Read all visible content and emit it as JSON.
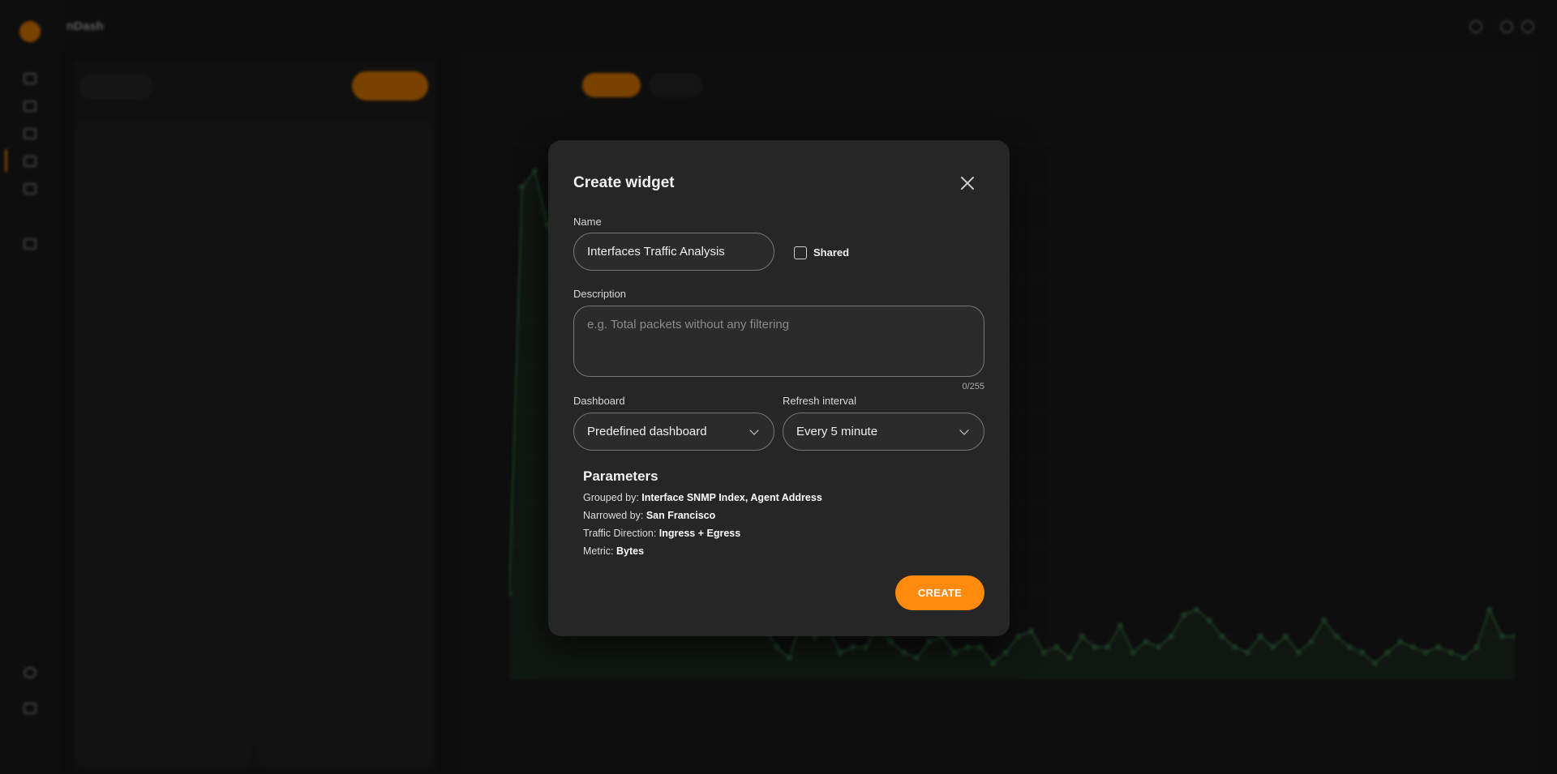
{
  "background": {
    "app_title": "nDash"
  },
  "modal": {
    "title": "Create widget",
    "name_label": "Name",
    "name_value": "Interfaces Traffic Analysis",
    "shared_label": "Shared",
    "shared_checked": false,
    "description_label": "Description",
    "description_placeholder": "e.g. Total packets without any filtering",
    "description_value": "",
    "char_counter": "0/255",
    "dashboard_label": "Dashboard",
    "dashboard_value": "Predefined dashboard",
    "refresh_label": "Refresh interval",
    "refresh_value": "Every 5 minute",
    "params_title": "Parameters",
    "params": [
      {
        "label": "Grouped by: ",
        "value": "Interface SNMP Index, Agent Address"
      },
      {
        "label": "Narrowed by: ",
        "value": "San Francisco"
      },
      {
        "label": "Traffic Direction: ",
        "value": "Ingress + Egress"
      },
      {
        "label": "Metric: ",
        "value": "Bytes"
      }
    ],
    "create_label": "CREATE"
  },
  "colors": {
    "accent": "#ff8a0c",
    "modal_bg": "#262626",
    "overlay": "rgba(0,0,0,0.52)",
    "chart_line": "#3b7d4a"
  },
  "background_chart": {
    "series": [
      0.16,
      0.92,
      0.95,
      0.85,
      0.8,
      0.75,
      0.7,
      0.65,
      0.6,
      0.55,
      0.5,
      0.45,
      0.4,
      0.35,
      0.3,
      0.25,
      0.2,
      0.18,
      0.15,
      0.13,
      0.1,
      0.06,
      0.04,
      0.12,
      0.08,
      0.1,
      0.05,
      0.06,
      0.06,
      0.1,
      0.07,
      0.05,
      0.04,
      0.07,
      0.08,
      0.05,
      0.06,
      0.06,
      0.03,
      0.05,
      0.08,
      0.09,
      0.05,
      0.06,
      0.04,
      0.08,
      0.06,
      0.06,
      0.1,
      0.05,
      0.07,
      0.06,
      0.08,
      0.12,
      0.13,
      0.11,
      0.08,
      0.06,
      0.05,
      0.08,
      0.06,
      0.08,
      0.05,
      0.07,
      0.11,
      0.08,
      0.06,
      0.05,
      0.03,
      0.05,
      0.07,
      0.06,
      0.05,
      0.06,
      0.05,
      0.04,
      0.06,
      0.13,
      0.08,
      0.08
    ]
  }
}
